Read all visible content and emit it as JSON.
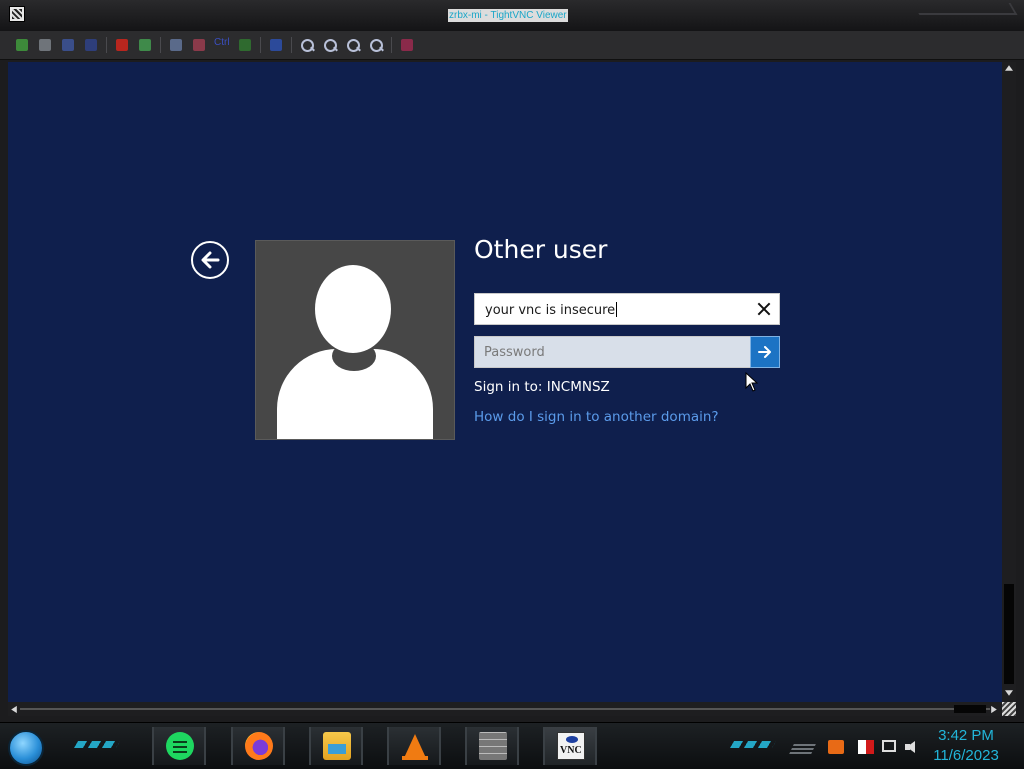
{
  "window": {
    "title": "zrbx-mi - TightVNC Viewer"
  },
  "toolbar": {
    "ctrl_label": "Ctrl",
    "buttons": [
      "new-connection-icon",
      "save-session-icon",
      "options-icon",
      "info-icon",
      "pause-icon",
      "refresh-icon",
      "ctrl-alt-del-icon",
      "ctrl-esc-icon",
      "ctrl-key-icon",
      "alt-key-icon",
      "transfer-files-icon",
      "zoom-in-icon",
      "zoom-out-icon",
      "zoom-100-icon",
      "zoom-auto-icon",
      "fullscreen-icon"
    ]
  },
  "login": {
    "title": "Other user",
    "username_value": "your vnc is insecure",
    "password_placeholder": "Password",
    "signin_domain": "Sign in to: INCMNSZ",
    "help_link": "How do I sign in to another domain?"
  },
  "taskbar": {
    "apps": [
      "spotify-icon",
      "firefox-icon",
      "file-manager-icon",
      "vlc-icon",
      "firewall-icon",
      "tightvnc-icon"
    ],
    "tray": [
      "chevron-icon",
      "notification-icon",
      "action-center-flag-icon",
      "network-icon",
      "volume-icon"
    ],
    "clock_time": "3:42 PM",
    "clock_date": "11/6/2023",
    "vnc_icon_text": "VNC"
  },
  "colors": {
    "remote_background": "#0f1f4d",
    "link": "#5b9bea",
    "submit_button": "#1c73c4",
    "clock": "#22b5d9"
  }
}
